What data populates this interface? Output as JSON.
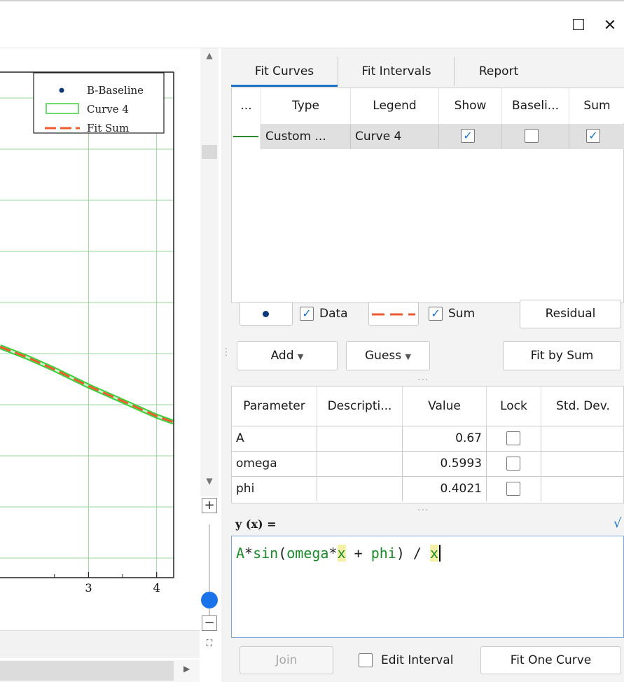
{
  "window": {
    "maximize_glyph": "☐",
    "close_glyph": "✕"
  },
  "colors": {
    "accent": "#1a73c8",
    "grid": "#9ad69a",
    "curve4": "#3cd13c",
    "fit_sum": "#ef5a2e",
    "baseline_dot": "#0d3a78"
  },
  "icons": {
    "maximize": "maximize-icon",
    "close": "close-icon",
    "scroll_up": "scroll-up-arrow-icon",
    "scroll_down": "scroll-down-arrow-icon",
    "zoom_in": "zoom-in-icon",
    "zoom_out": "zoom-out-icon",
    "fit": "fit-view-icon",
    "dropdown": "caret-down-icon",
    "check": "checkmark-icon"
  },
  "chart_data": {
    "type": "line",
    "title": "",
    "xlabel": "",
    "ylabel": "",
    "x_ticks": [
      "3",
      "4"
    ],
    "grid": true,
    "legend_position": "top-right",
    "legend": [
      {
        "label": "B-Baseline",
        "style": "dot"
      },
      {
        "label": "Curve 4",
        "style": "band"
      },
      {
        "label": "Fit Sum",
        "style": "dashed"
      }
    ],
    "curve_points": [
      {
        "x": 1.7,
        "y": 0.63
      },
      {
        "x": 2.1,
        "y": 0.56
      },
      {
        "x": 2.5,
        "y": 0.48
      },
      {
        "x": 3.0,
        "y": 0.37
      },
      {
        "x": 3.5,
        "y": 0.27
      },
      {
        "x": 4.0,
        "y": 0.17
      },
      {
        "x": 4.25,
        "y": 0.13
      }
    ],
    "xlim": [
      1.7,
      4.25
    ],
    "ylim": [
      -0.9,
      2.45
    ]
  },
  "tabs": {
    "fit_curves": "Fit Curves",
    "fit_intervals": "Fit Intervals",
    "report": "Report"
  },
  "curves_table": {
    "headers": [
      "...",
      "Type",
      "Legend",
      "Show",
      "Baseli...",
      "Sum"
    ],
    "rows": [
      {
        "type": "Custom ...",
        "legend": "Curve 4",
        "show": true,
        "baseline": false,
        "sum": true
      }
    ]
  },
  "controls": {
    "data_label": "Data",
    "data_checked": true,
    "sum_label": "Sum",
    "sum_checked": true,
    "residual": "Residual",
    "add": "Add",
    "guess": "Guess",
    "fit_by_sum": "Fit by Sum"
  },
  "params_table": {
    "headers": [
      "Parameter",
      "Descripti...",
      "Value",
      "Lock",
      "Std. Dev."
    ],
    "rows": [
      {
        "name": "A",
        "description": "",
        "value": "0.67",
        "lock": false,
        "std": ""
      },
      {
        "name": "omega",
        "description": "",
        "value": "0.5993",
        "lock": false,
        "std": ""
      },
      {
        "name": "phi",
        "description": "",
        "value": "0.4021",
        "lock": false,
        "std": ""
      }
    ]
  },
  "formula": {
    "label": "y (x) =",
    "tokens": [
      "A",
      "*",
      "sin",
      "(",
      "omega",
      "*",
      "x",
      " + ",
      "phi",
      ")",
      " / ",
      "x"
    ],
    "corner_glyph": "√"
  },
  "bottom": {
    "join": "Join",
    "edit_interval": "Edit Interval",
    "edit_interval_checked": false,
    "fit_one_curve": "Fit One Curve"
  }
}
